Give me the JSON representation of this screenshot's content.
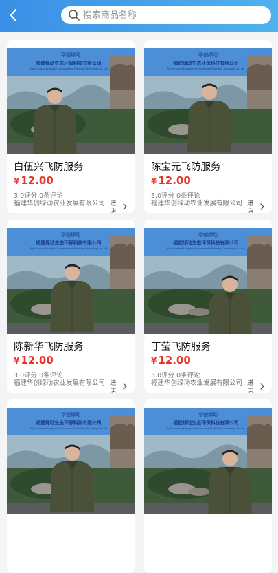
{
  "header": {
    "back_icon": "back-arrow-icon",
    "search_placeholder": "搜索商品名称",
    "search_icon": "search-icon"
  },
  "colors": {
    "header_start": "#3a8fe6",
    "header_end": "#4fb2ee",
    "price": "#e8352a"
  },
  "banner": {
    "company_cn": "福建绿动生态环保科技有限公司",
    "company_en": "Fujian Lvdong Ecological Environmental Protection Technology Co., Ltd",
    "logo_text": "华创绿动"
  },
  "products": [
    {
      "name": "白伍兴飞防服务",
      "currency": "¥",
      "price": "12.00",
      "rating": "3.0评分",
      "comments": "0条评论",
      "shop": "福建华创绿动农业发展有限公司",
      "enter": "进店"
    },
    {
      "name": "陈宝元飞防服务",
      "currency": "¥",
      "price": "12.00",
      "rating": "3.0评分",
      "comments": "0条评论",
      "shop": "福建华创绿动农业发展有限公司",
      "enter": "进店"
    },
    {
      "name": "陈新华飞防服务",
      "currency": "¥",
      "price": "12.00",
      "rating": "3.0评分",
      "comments": "0条评论",
      "shop": "福建华创绿动农业发展有限公司",
      "enter": "进店"
    },
    {
      "name": "丁莹飞防服务",
      "currency": "¥",
      "price": "12.00",
      "rating": "3.0评分",
      "comments": "0条评论",
      "shop": "福建华创绿动农业发展有限公司",
      "enter": "进店"
    },
    {
      "name": "",
      "currency": "",
      "price": "",
      "rating": "",
      "comments": "",
      "shop": "",
      "enter": ""
    },
    {
      "name": "",
      "currency": "",
      "price": "",
      "rating": "",
      "comments": "",
      "shop": "",
      "enter": ""
    }
  ]
}
